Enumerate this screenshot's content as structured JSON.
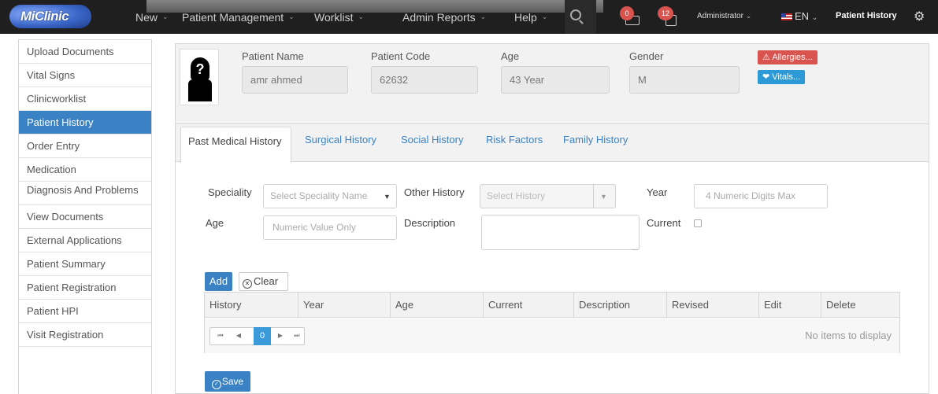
{
  "header": {
    "logo_text": "MiClinic",
    "nav": [
      {
        "label": "New"
      },
      {
        "label": "Patient Management"
      },
      {
        "label": "Worklist"
      },
      {
        "label": "Admin Reports"
      },
      {
        "label": "Help"
      }
    ],
    "messages_badge": "0",
    "calendar_badge": "12",
    "user": "Administrator",
    "language": "EN",
    "page_title": "Patient History"
  },
  "sidebar": {
    "items": [
      {
        "label": "Upload Documents"
      },
      {
        "label": "Vital Signs"
      },
      {
        "label": "Clinicworklist"
      },
      {
        "label": "Patient History",
        "active": true
      },
      {
        "label": "Order Entry"
      },
      {
        "label": "Medication"
      },
      {
        "label": "Diagnosis And Problems"
      },
      {
        "label": "View Documents"
      },
      {
        "label": "External Applications"
      },
      {
        "label": "Patient Summary"
      },
      {
        "label": "Patient Registration"
      },
      {
        "label": "Patient HPI"
      },
      {
        "label": "Visit Registration"
      }
    ]
  },
  "patient": {
    "name_label": "Patient Name",
    "name": "amr ahmed",
    "code_label": "Patient Code",
    "code": "62632",
    "age_label": "Age",
    "age": "43 Year",
    "gender_label": "Gender",
    "gender": "M",
    "allergies_button": "Allergies...",
    "vitals_button": "Vitals..."
  },
  "tabs": [
    {
      "label": "Past Medical History",
      "active": true
    },
    {
      "label": "Surgical History"
    },
    {
      "label": "Social History"
    },
    {
      "label": "Risk Factors"
    },
    {
      "label": "Family History"
    }
  ],
  "form": {
    "speciality_label": "Speciality",
    "speciality_placeholder": "Select Speciality Name",
    "other_history_label": "Other History",
    "other_history_placeholder": "Select History",
    "year_label": "Year",
    "year_placeholder": "4 Numeric Digits Max",
    "age_label": "Age",
    "age_placeholder": "Numeric Value Only",
    "description_label": "Description",
    "current_label": "Current",
    "add_button": "Add",
    "clear_button": "Clear"
  },
  "grid": {
    "columns": [
      "History",
      "Year",
      "Age",
      "Current",
      "Description",
      "Revised",
      "Edit",
      "Delete"
    ],
    "page": "0",
    "empty_text": "No items to display"
  },
  "save_button": "Save",
  "colors": {
    "topbar": "#1f1f1f",
    "accent": "#3b82c4",
    "danger": "#d9534f",
    "info": "#2b9ad6"
  }
}
